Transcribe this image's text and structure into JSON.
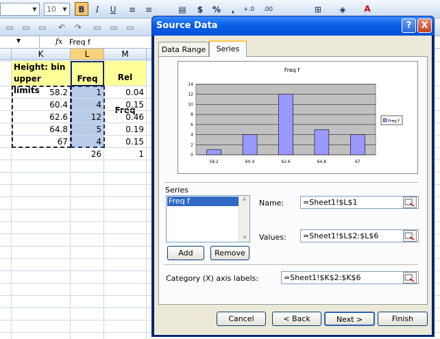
{
  "toolbar": {
    "font_size": "10",
    "bold": "B",
    "italic": "I",
    "underline": "U",
    "currency": "$",
    "percent": "%",
    "comma": ",",
    "inc_decimal": "+.0",
    "dec_decimal": ".00"
  },
  "formula_bar": {
    "fx": "fx",
    "content": "Freq f"
  },
  "sheet": {
    "columns": [
      "K",
      "L",
      "M"
    ],
    "header_k": "Height: bin upper limits",
    "header_k1": "Height: bin",
    "header_k2": "upper limits",
    "header_l": "Freq f",
    "header_m": "Rel Freq",
    "rows": [
      {
        "k": "58.2",
        "l": "1",
        "m": "0.04"
      },
      {
        "k": "60.4",
        "l": "4",
        "m": "0.15"
      },
      {
        "k": "62.6",
        "l": "12",
        "m": "0.46"
      },
      {
        "k": "64.8",
        "l": "5",
        "m": "0.19"
      },
      {
        "k": "67",
        "l": "4",
        "m": "0.15"
      }
    ],
    "total_l": "26",
    "total_m": "1"
  },
  "dialog": {
    "title": "Source Data",
    "help": "?",
    "close": "X",
    "tabs": [
      "Data Range",
      "Series"
    ],
    "series_group_label": "Series",
    "series_items": [
      "Freq f"
    ],
    "name_label": "Name:",
    "name_value": "=Sheet1!$L$1",
    "values_label": "Values:",
    "values_value": "=Sheet1!$L$2:$L$6",
    "add_label": "Add",
    "remove_label": "Remove",
    "category_label": "Category (X) axis labels:",
    "category_value": "=Sheet1!$K$2:$K$6",
    "cancel_label": "Cancel",
    "back_label": "< Back",
    "next_label": "Next >",
    "finish_label": "Finish"
  },
  "chart_data": {
    "type": "bar",
    "title": "Freq f",
    "categories": [
      "58.2",
      "60.4",
      "62.6",
      "64.8",
      "67"
    ],
    "series": [
      {
        "name": "Freq f",
        "values": [
          1,
          4,
          12,
          5,
          4
        ]
      }
    ],
    "ylim": [
      0,
      14
    ],
    "yticks": [
      "0",
      "2",
      "4",
      "6",
      "8",
      "10",
      "12",
      "14"
    ],
    "grid": true,
    "legend": "right",
    "colors": {
      "bar": "#9999ff",
      "plot_bg": "#c0c0c0"
    }
  }
}
